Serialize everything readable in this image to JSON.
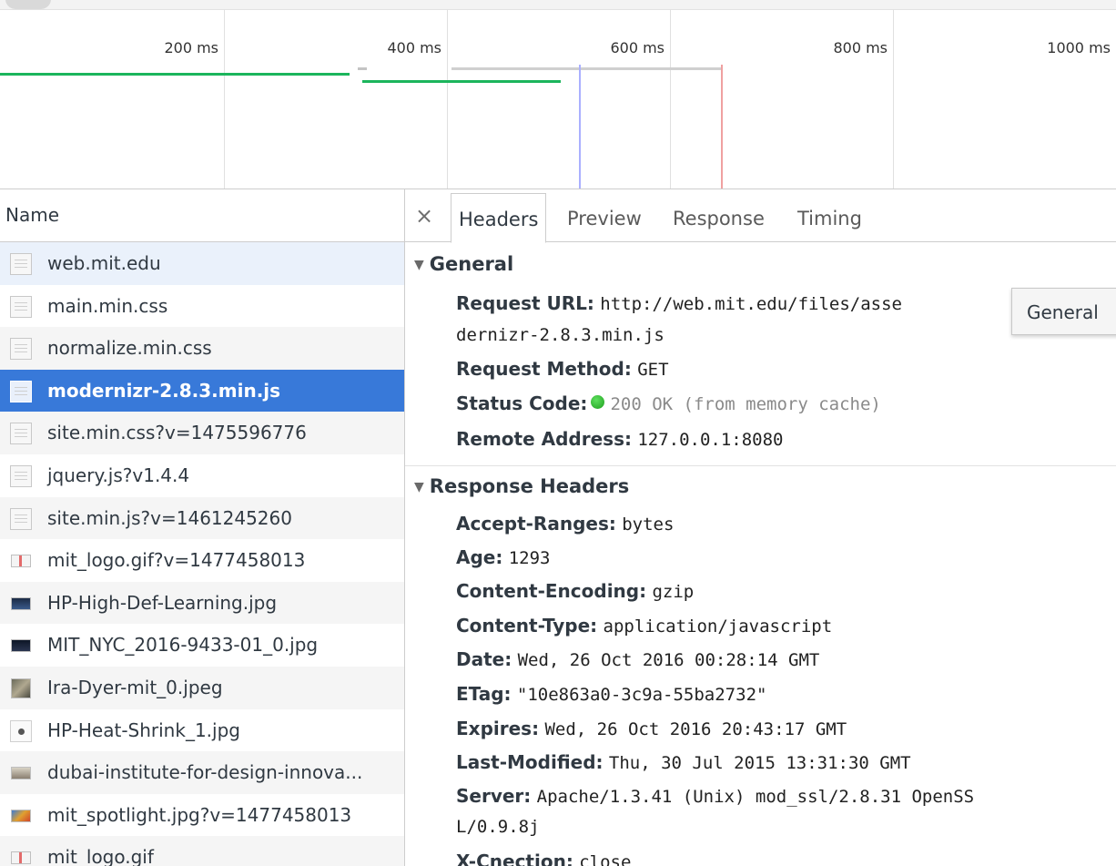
{
  "timeline": {
    "ticks": [
      "200 ms",
      "400 ms",
      "600 ms",
      "800 ms",
      "1000 ms"
    ]
  },
  "list": {
    "header": "Name",
    "rows": [
      {
        "name": "web.mit.edu",
        "icon": "document-icon"
      },
      {
        "name": "main.min.css",
        "icon": "document-icon"
      },
      {
        "name": "normalize.min.css",
        "icon": "document-icon"
      },
      {
        "name": "modernizr-2.8.3.min.js",
        "icon": "document-icon"
      },
      {
        "name": "site.min.css?v=1475596776",
        "icon": "document-icon"
      },
      {
        "name": "jquery.js?v1.4.4",
        "icon": "document-icon"
      },
      {
        "name": "site.min.js?v=1461245260",
        "icon": "document-icon"
      },
      {
        "name": "mit_logo.gif?v=1477458013",
        "icon": "image-thumbnail-icon"
      },
      {
        "name": "HP-High-Def-Learning.jpg",
        "icon": "image-thumbnail-icon"
      },
      {
        "name": "MIT_NYC_2016-9433-01_0.jpg",
        "icon": "image-thumbnail-icon"
      },
      {
        "name": "Ira-Dyer-mit_0.jpeg",
        "icon": "image-thumbnail-icon"
      },
      {
        "name": "HP-Heat-Shrink_1.jpg",
        "icon": "image-thumbnail-icon"
      },
      {
        "name": "dubai-institute-for-design-innova...",
        "icon": "image-thumbnail-icon"
      },
      {
        "name": "mit_spotlight.jpg?v=1477458013",
        "icon": "image-thumbnail-icon"
      },
      {
        "name": "mit_logo.gif",
        "icon": "image-thumbnail-icon"
      }
    ]
  },
  "details": {
    "close_glyph": "×",
    "tabs": [
      "Headers",
      "Preview",
      "Response",
      "Timing"
    ],
    "general": {
      "title": "General",
      "request_url_key": "Request URL:",
      "request_url_line1": "http://web.mit.edu/files/asse",
      "request_url_line2": "dernizr-2.8.3.min.js",
      "request_method_key": "Request Method:",
      "request_method": "GET",
      "status_code_key": "Status Code:",
      "status_code": "200 OK (from memory cache)",
      "status_color": "#22a822",
      "remote_address_key": "Remote Address:",
      "remote_address": "127.0.0.1:8080"
    },
    "tooltip": "General",
    "response_headers": {
      "title": "Response Headers",
      "items": [
        {
          "key": "Accept-Ranges:",
          "value": "bytes"
        },
        {
          "key": "Age:",
          "value": "1293"
        },
        {
          "key": "Content-Encoding:",
          "value": "gzip"
        },
        {
          "key": "Content-Type:",
          "value": "application/javascript"
        },
        {
          "key": "Date:",
          "value": "Wed, 26 Oct 2016 00:28:14 GMT"
        },
        {
          "key": "ETag:",
          "value": "\"10e863a0-3c9a-55ba2732\""
        },
        {
          "key": "Expires:",
          "value": "Wed, 26 Oct 2016 20:43:17 GMT"
        },
        {
          "key": "Last-Modified:",
          "value": "Thu, 30 Jul 2015 13:31:30 GMT"
        },
        {
          "key": "Server:",
          "value": "Apache/1.3.41 (Unix) mod_ssl/2.8.31 OpenSS"
        },
        {
          "key": "",
          "value": "L/0.9.8j"
        },
        {
          "key": "X-Cnection:",
          "value": "close"
        }
      ]
    }
  },
  "colors": {
    "selected_row": "#3879d9",
    "waterfall_green": "#1bb55c",
    "dom_content_loaded_line": "#9aa0ff",
    "load_line": "#f09090"
  }
}
